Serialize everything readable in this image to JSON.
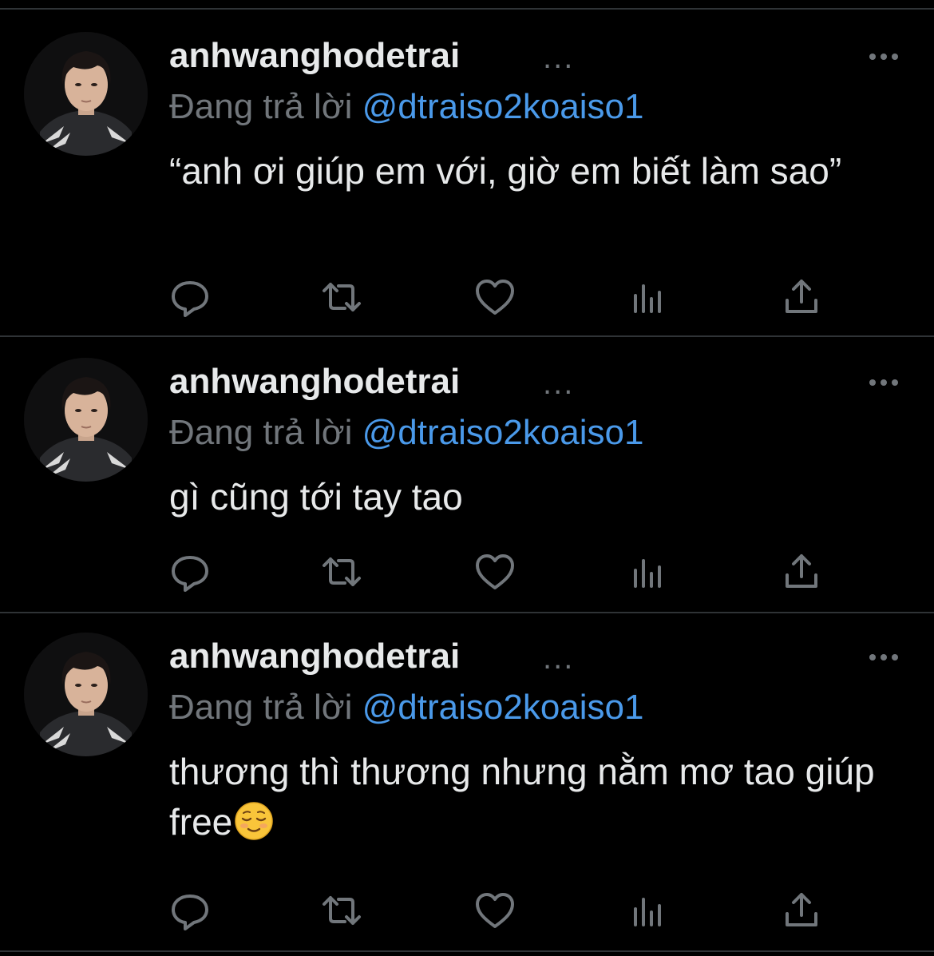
{
  "tweets": [
    {
      "username": "anhwanghodetrai",
      "name_overflow": "...",
      "reply_prefix": "Đang trả lời",
      "reply_handle": "@dtraiso2koaiso1",
      "text": "“anh ơi giúp em với, giờ em biết làm sao”",
      "has_emoji": false
    },
    {
      "username": "anhwanghodetrai",
      "name_overflow": "...",
      "reply_prefix": "Đang trả lời",
      "reply_handle": "@dtraiso2koaiso1",
      "text": "gì cũng tới tay tao",
      "has_emoji": false
    },
    {
      "username": "anhwanghodetrai",
      "name_overflow": "...",
      "reply_prefix": "Đang trả lời",
      "reply_handle": "@dtraiso2koaiso1",
      "text": "thương thì thương nhưng nằm mơ tao giúp free",
      "has_emoji": true,
      "emoji_icon": "relieved-face-emoji"
    }
  ],
  "actions": [
    "reply-icon",
    "retweet-icon",
    "like-icon",
    "analytics-icon",
    "share-icon"
  ],
  "colors": {
    "background": "#000000",
    "text": "#e7e9ea",
    "muted": "#71767b",
    "link": "#4a99e9",
    "divider": "#2f3336"
  }
}
